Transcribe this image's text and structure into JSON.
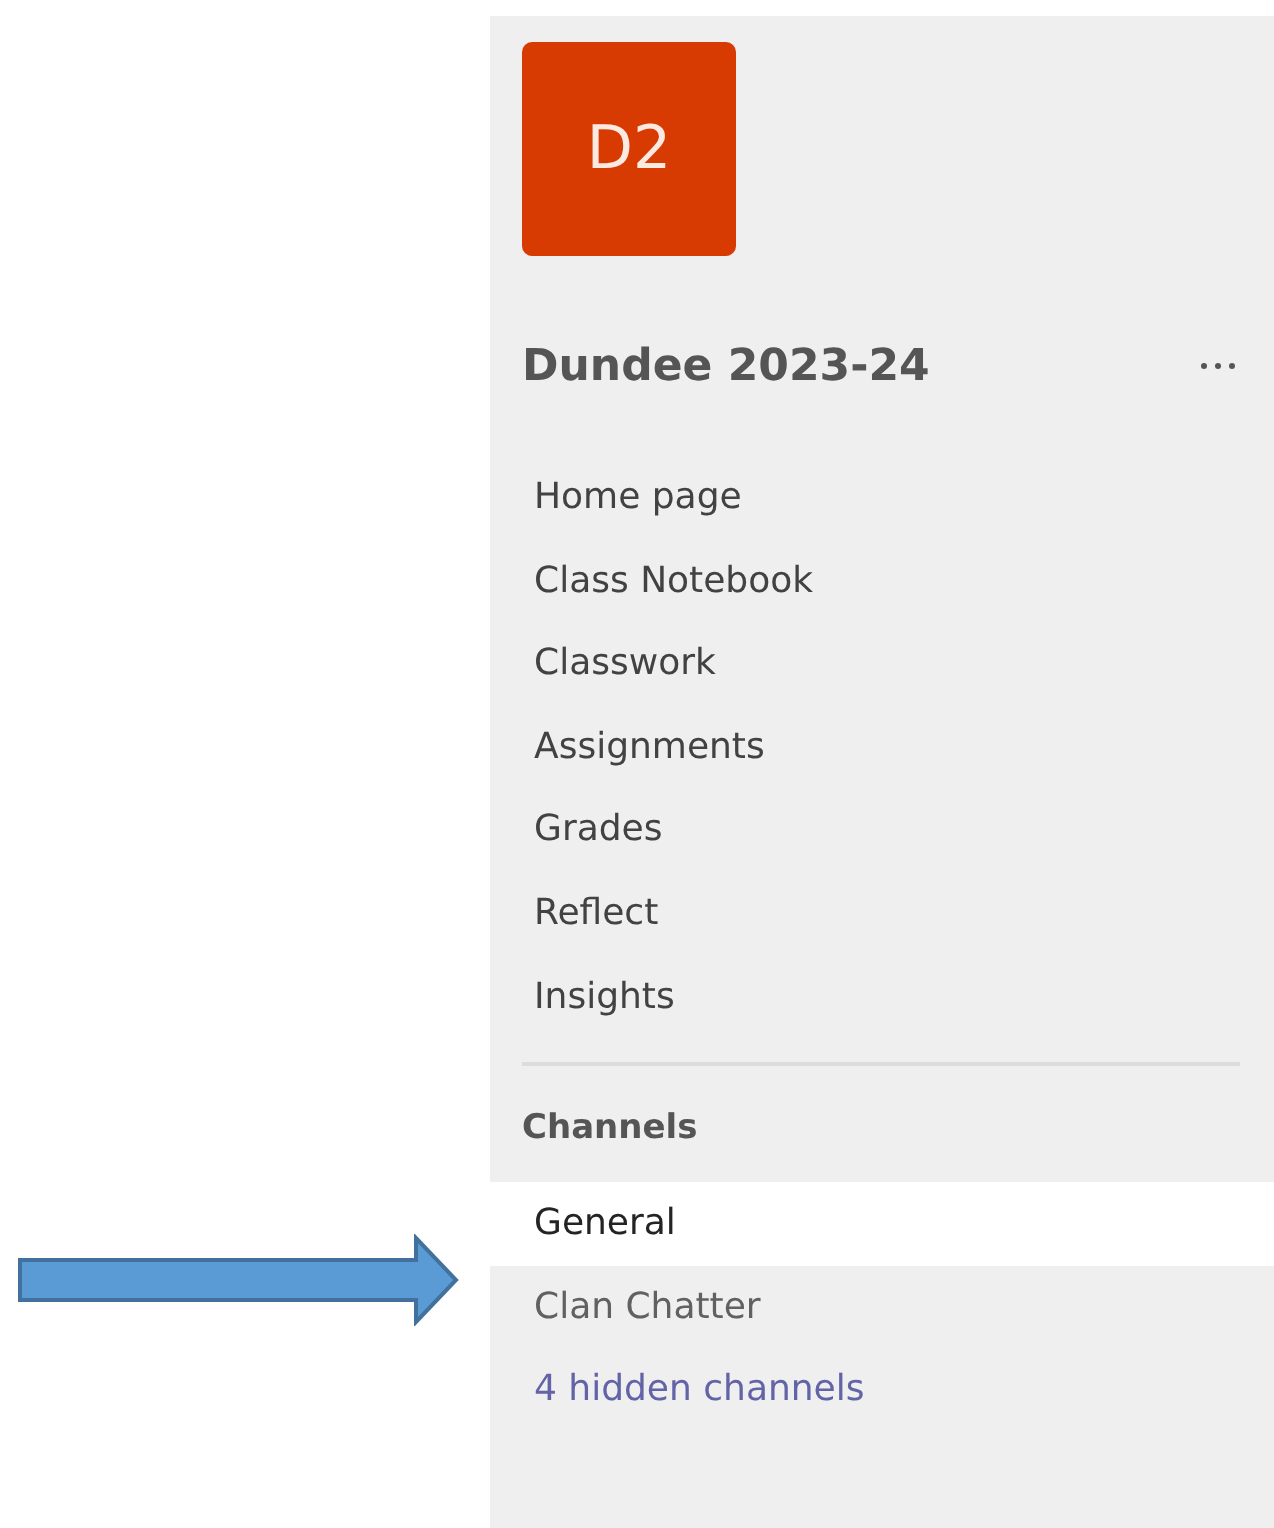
{
  "team": {
    "initials": "D2",
    "name": "Dundee 2023-24"
  },
  "nav_items": [
    {
      "label": "Home page"
    },
    {
      "label": "Class Notebook"
    },
    {
      "label": "Classwork"
    },
    {
      "label": "Assignments"
    },
    {
      "label": "Grades"
    },
    {
      "label": "Reflect"
    },
    {
      "label": "Insights"
    }
  ],
  "channels": {
    "heading": "Channels",
    "items": [
      {
        "label": "General",
        "selected": true
      },
      {
        "label": "Clan Chatter",
        "selected": false
      }
    ],
    "hidden_link": "4 hidden channels"
  }
}
